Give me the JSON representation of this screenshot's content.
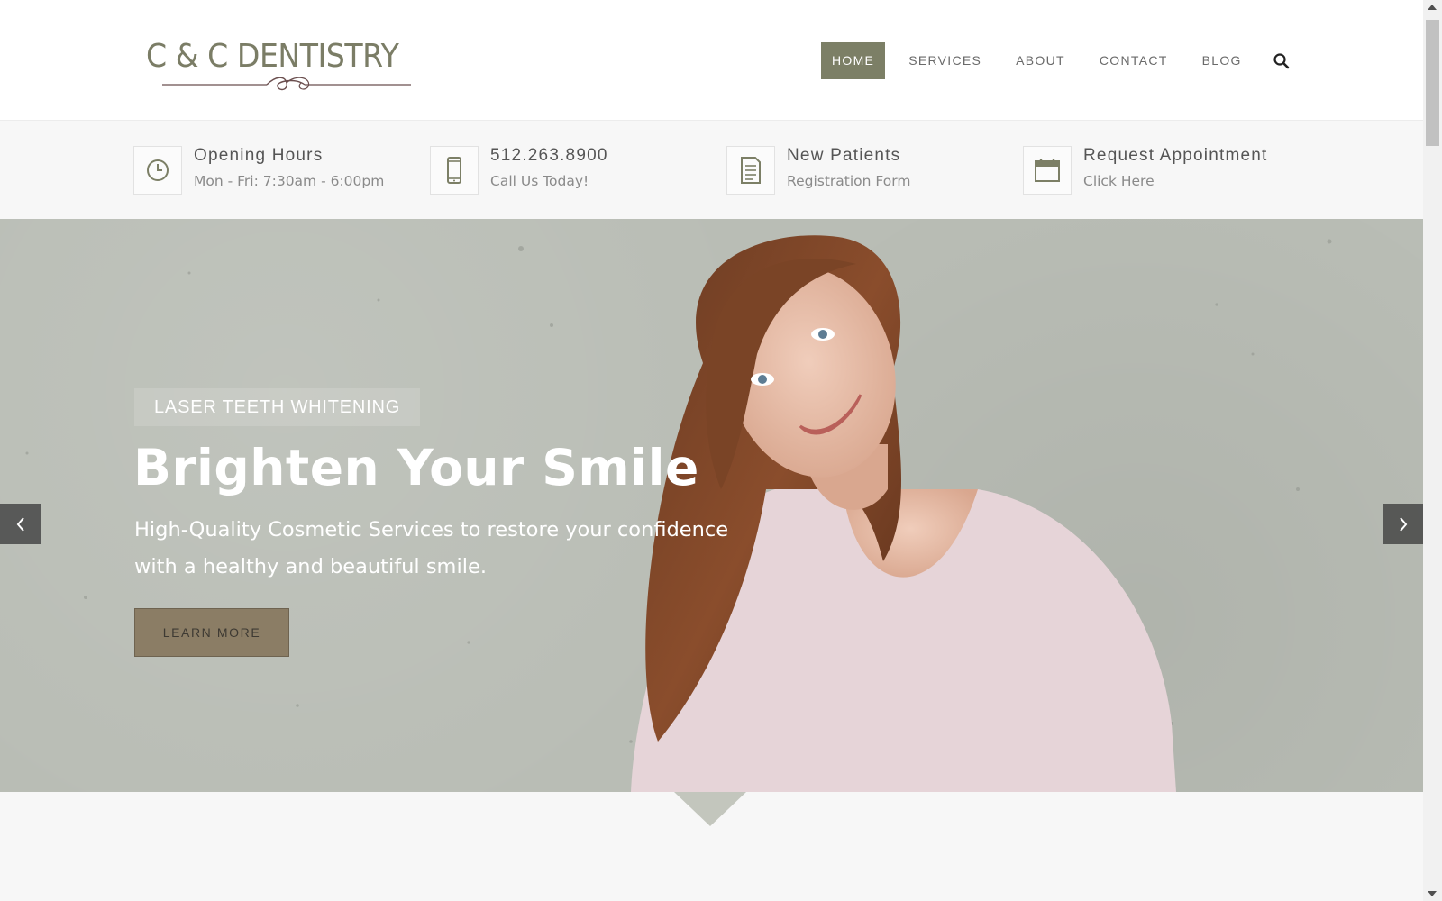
{
  "logo": {
    "text": "C & C DENTISTRY"
  },
  "nav": {
    "items": [
      {
        "label": "HOME",
        "active": true
      },
      {
        "label": "SERVICES",
        "active": false
      },
      {
        "label": "ABOUT",
        "active": false
      },
      {
        "label": "CONTACT",
        "active": false
      },
      {
        "label": "BLOG",
        "active": false
      }
    ],
    "search_icon": "search-icon"
  },
  "info": [
    {
      "icon": "clock-icon",
      "title": "Opening Hours",
      "subtitle": "Mon - Fri: 7:30am - 6:00pm"
    },
    {
      "icon": "phone-icon",
      "title": "512.263.8900",
      "subtitle": "Call Us Today!"
    },
    {
      "icon": "document-icon",
      "title": "New Patients",
      "subtitle": "Registration Form"
    },
    {
      "icon": "calendar-icon",
      "title": "Request Appointment",
      "subtitle": "Click Here"
    }
  ],
  "hero": {
    "tagline": "LASER TEETH WHITENING",
    "title": "Brighten Your Smile",
    "text": "High-Quality Cosmetic Services to restore your confidence with a healthy and beautiful smile.",
    "button_label": "LEARN MORE"
  },
  "colors": {
    "accent": "#7c7f66",
    "button": "#8b7d65",
    "hero_background": "#b9bdb5"
  }
}
